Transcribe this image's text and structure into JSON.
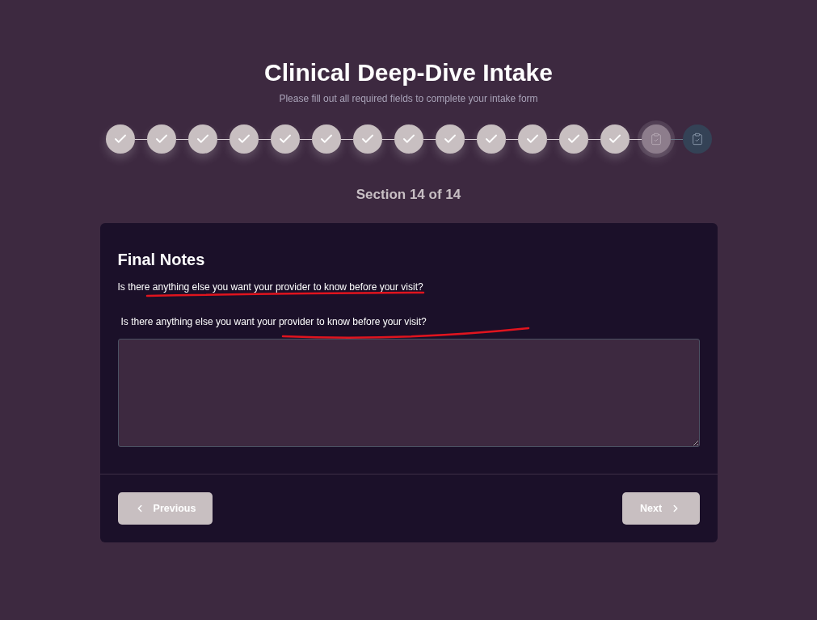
{
  "header": {
    "title": "Clinical Deep-Dive Intake",
    "subtitle": "Please fill out all required fields to complete your intake form"
  },
  "steps": [
    {
      "completed": true,
      "selected": false
    },
    {
      "completed": true,
      "selected": false
    },
    {
      "completed": true,
      "selected": false
    },
    {
      "completed": true,
      "selected": false
    },
    {
      "completed": true,
      "selected": false
    },
    {
      "completed": true,
      "selected": false
    },
    {
      "completed": true,
      "selected": false
    },
    {
      "completed": true,
      "selected": false
    },
    {
      "completed": true,
      "selected": false
    },
    {
      "completed": true,
      "selected": false
    },
    {
      "completed": true,
      "selected": false
    },
    {
      "completed": true,
      "selected": false
    },
    {
      "completed": true,
      "selected": false
    },
    {
      "completed": false,
      "selected": true
    },
    {
      "completed": false,
      "selected": false
    }
  ],
  "section_indicator": "Section 14 of 14",
  "section": {
    "title": "Final Notes",
    "description": "Is there anything else you want your provider to know before your visit?",
    "field": {
      "label": "Is there anything else you want your provider to know before your visit?"
    }
  },
  "navigation": [
    {
      "kind": "previous",
      "label": "Previous"
    },
    {
      "kind": "next",
      "label": "Next"
    }
  ]
}
